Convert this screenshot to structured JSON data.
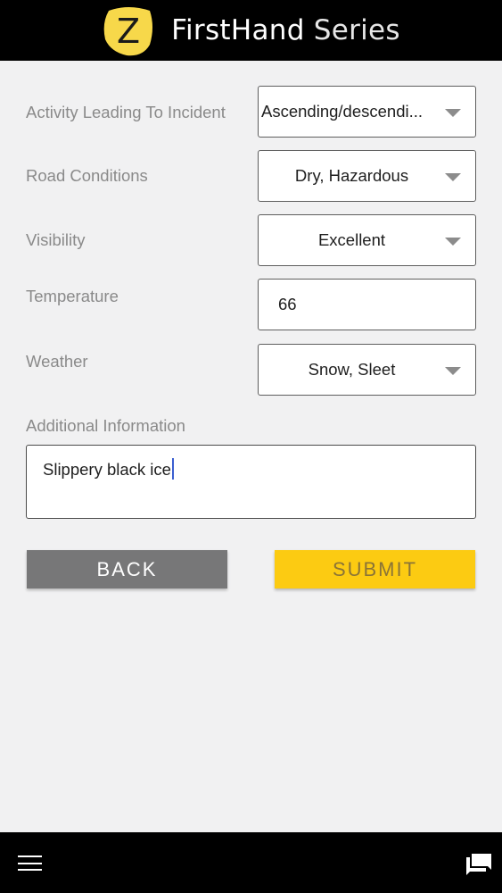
{
  "header": {
    "logo_letter": "Z",
    "brand_first": "FirstHand",
    "brand_second": "Series"
  },
  "form": {
    "activity": {
      "label": "Activity Leading To Incident",
      "value": "Ascending/descendi..."
    },
    "road_conditions": {
      "label": "Road Conditions",
      "value": "Dry, Hazardous"
    },
    "visibility": {
      "label": "Visibility",
      "value": "Excellent"
    },
    "temperature": {
      "label": "Temperature",
      "value": "66"
    },
    "weather": {
      "label": "Weather",
      "value": "Snow, Sleet"
    },
    "additional_info": {
      "label": "Additional Information",
      "value": "Slippery black ice"
    }
  },
  "buttons": {
    "back": "BACK",
    "submit": "SUBMIT"
  },
  "colors": {
    "header_bg": "#000000",
    "logo_yellow": "#f7d84a",
    "submit_yellow": "#fccb12",
    "back_gray": "#777778",
    "cursor_blue": "#3b5fd0"
  },
  "icons": {
    "menu": "hamburger-menu-icon",
    "chat": "chat-bubble-icon",
    "dropdown": "caret-down-icon"
  }
}
